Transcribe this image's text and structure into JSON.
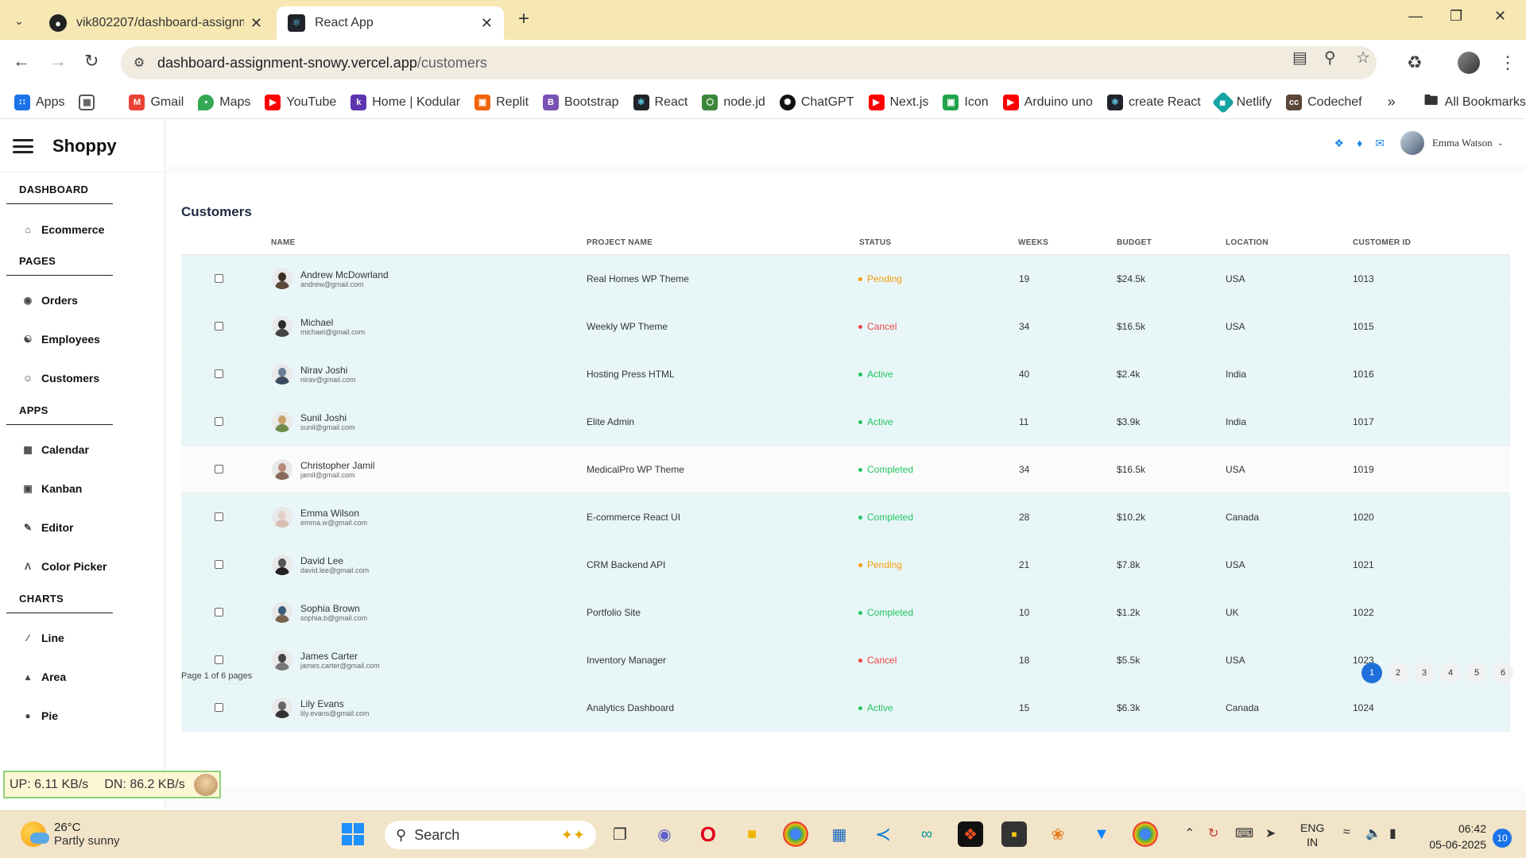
{
  "browser": {
    "tabs": [
      {
        "title": "vik802207/dashboard-assignme",
        "icon": "github-icon"
      },
      {
        "title": "React App",
        "icon": "react-icon"
      }
    ],
    "url_host": "dashboard-assignment-snowy.vercel.app",
    "url_path": "/customers",
    "bookmarks": [
      {
        "label": "Apps",
        "icon": "apps-grid-icon",
        "color": "#1a73e8"
      },
      {
        "label": "",
        "icon": "tile-grid-icon",
        "color": "#555555"
      },
      {
        "label": "Gmail",
        "icon": "gmail-icon",
        "color": "#ea4335"
      },
      {
        "label": "Maps",
        "icon": "maps-icon",
        "color": "#34a853"
      },
      {
        "label": "YouTube",
        "icon": "youtube-icon",
        "color": "#ff0000"
      },
      {
        "label": "Home | Kodular",
        "icon": "kodular-icon",
        "color": "#5e35b1"
      },
      {
        "label": "Replit",
        "icon": "replit-icon",
        "color": "#f26207"
      },
      {
        "label": "Bootstrap",
        "icon": "bootstrap-icon",
        "color": "#7952b3"
      },
      {
        "label": "React",
        "icon": "react-icon",
        "color": "#20232a"
      },
      {
        "label": "node.jd",
        "icon": "nodejs-icon",
        "color": "#3c873a"
      },
      {
        "label": "ChatGPT",
        "icon": "chatgpt-icon",
        "color": "#111111"
      },
      {
        "label": "Next.js",
        "icon": "youtube-icon",
        "color": "#ff0000"
      },
      {
        "label": "Icon",
        "icon": "icon-site-icon",
        "color": "#1fa34a"
      },
      {
        "label": "Arduino uno",
        "icon": "youtube-icon",
        "color": "#ff0000"
      },
      {
        "label": "create React",
        "icon": "react-icon",
        "color": "#20232a"
      },
      {
        "label": "Netlify",
        "icon": "netlify-icon",
        "color": "#15a3a3"
      },
      {
        "label": "Codechef",
        "icon": "codechef-icon",
        "color": "#5b4638"
      }
    ],
    "all_bookmarks": "All Bookmarks"
  },
  "sidebar": {
    "brand": "Shoppy",
    "sections": [
      {
        "title": "DASHBOARD",
        "items": [
          {
            "label": "Ecommerce",
            "icon": "home-icon"
          }
        ]
      },
      {
        "title": "PAGES",
        "items": [
          {
            "label": "Orders",
            "icon": "pin-icon"
          },
          {
            "label": "Employees",
            "icon": "people-icon"
          },
          {
            "label": "Customers",
            "icon": "person-icon"
          }
        ]
      },
      {
        "title": "APPS",
        "items": [
          {
            "label": "Calendar",
            "icon": "calendar-icon"
          },
          {
            "label": "Kanban",
            "icon": "kanban-icon"
          },
          {
            "label": "Editor",
            "icon": "pencil-icon"
          },
          {
            "label": "Color Picker",
            "icon": "color-picker-icon"
          }
        ]
      },
      {
        "title": "CHARTS",
        "items": [
          {
            "label": "Line",
            "icon": "line-chart-icon"
          },
          {
            "label": "Area",
            "icon": "area-chart-icon"
          },
          {
            "label": "Pie",
            "icon": "pie-chart-icon"
          }
        ]
      }
    ]
  },
  "topbar": {
    "user_name": "Emma Watson"
  },
  "page": {
    "title": "Customers",
    "columns": [
      "NAME",
      "PROJECT NAME",
      "STATUS",
      "WEEKS",
      "BUDGET",
      "LOCATION",
      "CUSTOMER ID"
    ],
    "rows": [
      {
        "name": "Andrew McDowrland",
        "email": "andrew@gmail.com",
        "project": "Real Homes WP Theme",
        "status": "Pending",
        "weeks": "19",
        "budget": "$24.5k",
        "location": "USA",
        "id": "1013"
      },
      {
        "name": "Michael",
        "email": "michael@gmail.com",
        "project": "Weekly WP Theme",
        "status": "Cancel",
        "weeks": "34",
        "budget": "$16.5k",
        "location": "USA",
        "id": "1015"
      },
      {
        "name": "Nirav Joshi",
        "email": "nirav@gmail.com",
        "project": "Hosting Press HTML",
        "status": "Active",
        "weeks": "40",
        "budget": "$2.4k",
        "location": "India",
        "id": "1016"
      },
      {
        "name": "Sunil Joshi",
        "email": "sunil@gmail.com",
        "project": "Elite Admin",
        "status": "Active",
        "weeks": "11",
        "budget": "$3.9k",
        "location": "India",
        "id": "1017"
      },
      {
        "name": "Christopher Jamil",
        "email": "jamil@gmail.com",
        "project": "MedicalPro WP Theme",
        "status": "Completed",
        "weeks": "34",
        "budget": "$16.5k",
        "location": "USA",
        "id": "1019"
      },
      {
        "name": "Emma Wilson",
        "email": "emma.w@gmail.com",
        "project": "E-commerce React UI",
        "status": "Completed",
        "weeks": "28",
        "budget": "$10.2k",
        "location": "Canada",
        "id": "1020"
      },
      {
        "name": "David Lee",
        "email": "david.lee@gmail.com",
        "project": "CRM Backend API",
        "status": "Pending",
        "weeks": "21",
        "budget": "$7.8k",
        "location": "USA",
        "id": "1021"
      },
      {
        "name": "Sophia Brown",
        "email": "sophia.b@gmail.com",
        "project": "Portfolio Site",
        "status": "Completed",
        "weeks": "10",
        "budget": "$1.2k",
        "location": "UK",
        "id": "1022"
      },
      {
        "name": "James Carter",
        "email": "james.carter@gmail.com",
        "project": "Inventory Manager",
        "status": "Cancel",
        "weeks": "18",
        "budget": "$5.5k",
        "location": "USA",
        "id": "1023"
      },
      {
        "name": "Lily Evans",
        "email": "lily.evans@gmail.com",
        "project": "Analytics Dashboard",
        "status": "Active",
        "weeks": "15",
        "budget": "$6.3k",
        "location": "Canada",
        "id": "1024"
      }
    ],
    "status_colors": {
      "Pending": "#f59e0b",
      "Cancel": "#ef4444",
      "Active": "#22c55e",
      "Completed": "#22c55e"
    },
    "pager_text": "Page 1 of 6 pages",
    "pages": [
      "1",
      "2",
      "3",
      "4",
      "5",
      "6"
    ]
  },
  "net_meter": {
    "up": "UP: 6.11 KB/s",
    "down": "DN: 86.2 KB/s"
  },
  "taskbar": {
    "temperature": "26°C",
    "condition": "Partly sunny",
    "search_placeholder": "Search",
    "lang_top": "ENG",
    "lang_bottom": "IN",
    "time": "06:42",
    "date": "05-06-2025",
    "notifications": "10"
  }
}
